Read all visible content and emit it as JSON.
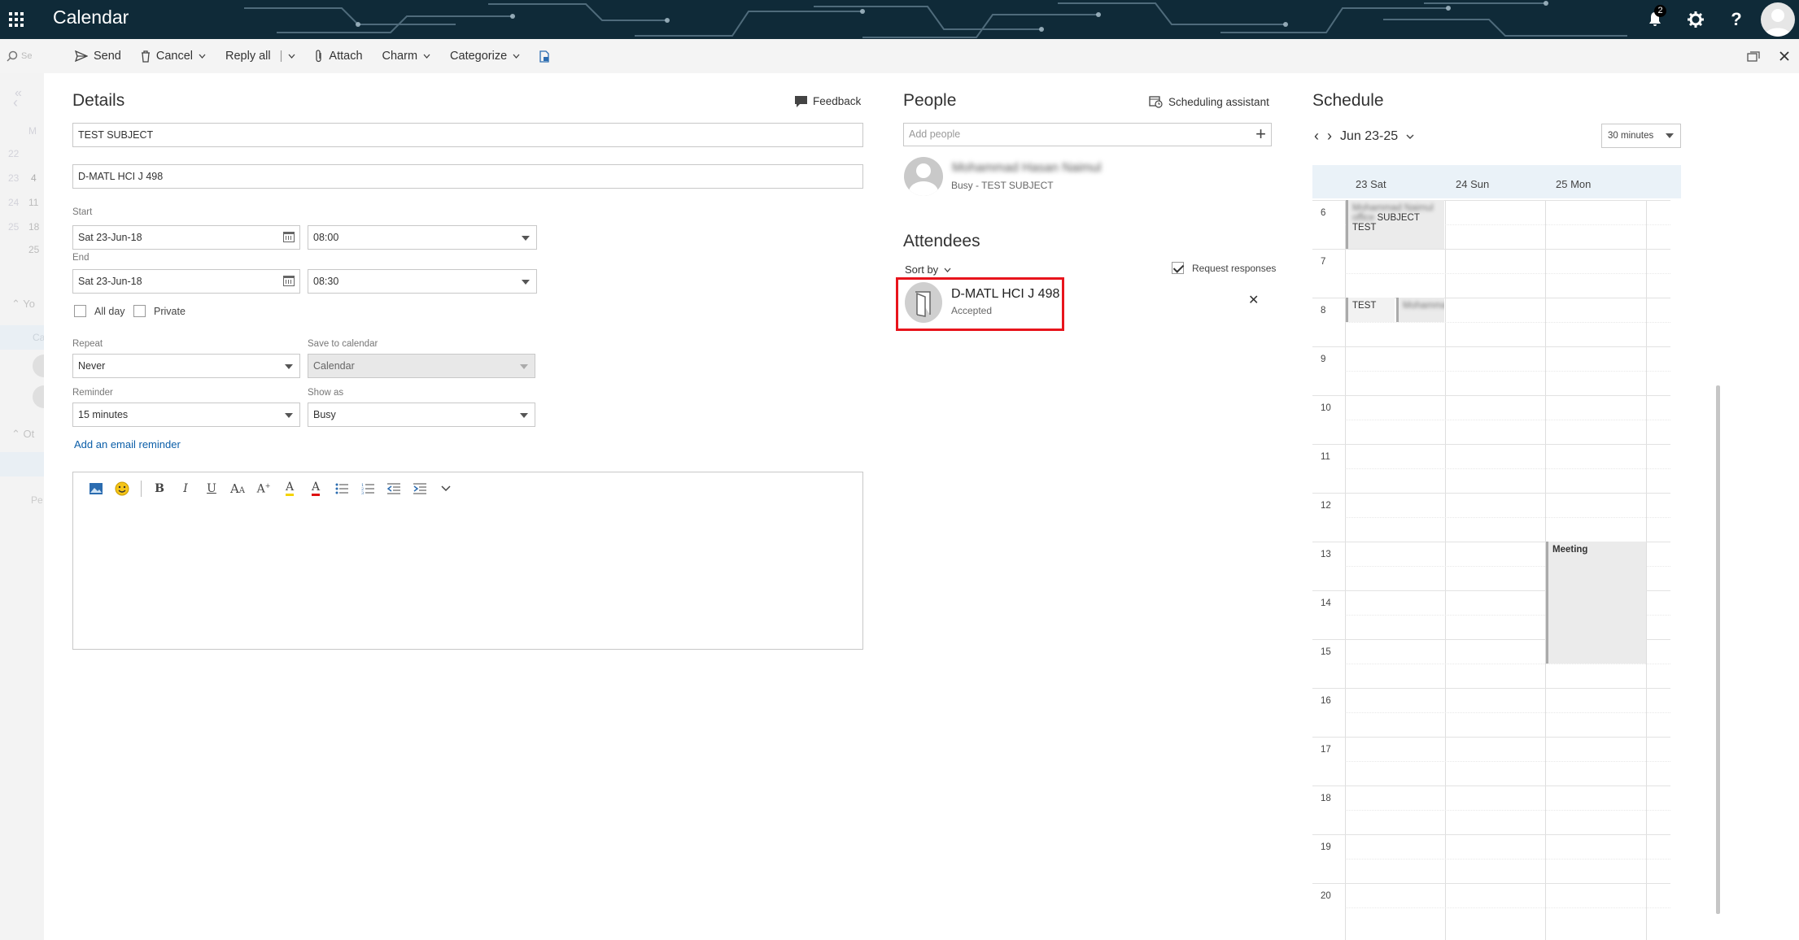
{
  "app": {
    "title": "Calendar",
    "notification_count": "2"
  },
  "toolbar": {
    "search_placeholder": "Se",
    "send": "Send",
    "cancel": "Cancel",
    "reply_all": "Reply all",
    "attach": "Attach",
    "charm": "Charm",
    "categorize": "Categorize"
  },
  "rail": {
    "month_letter": "M",
    "week_nums": [
      "22",
      "23",
      "24",
      "25"
    ],
    "dates": [
      "4",
      "11",
      "18",
      "25"
    ],
    "your_calendars": "Yo",
    "other_calendars": "Ot",
    "cal_item": "Ca",
    "people": "Pe"
  },
  "details": {
    "title": "Details",
    "feedback": "Feedback",
    "subject": "TEST SUBJECT",
    "location": "D-MATL HCI J 498",
    "start_label": "Start",
    "start_date": "Sat 23-Jun-18",
    "start_time": "08:00",
    "end_label": "End",
    "end_date": "Sat 23-Jun-18",
    "end_time": "08:30",
    "all_day": "All day",
    "private": "Private",
    "repeat_label": "Repeat",
    "repeat_value": "Never",
    "save_label": "Save to calendar",
    "save_value": "Calendar",
    "reminder_label": "Reminder",
    "reminder_value": "15 minutes",
    "show_as_label": "Show as",
    "show_as_value": "Busy",
    "email_reminder": "Add an email reminder"
  },
  "people": {
    "title": "People",
    "scheduling_assistant": "Scheduling assistant",
    "add_placeholder": "Add people",
    "organizer_name": "Mohammad Hasan Naimul",
    "organizer_status": "Busy - TEST SUBJECT"
  },
  "attendees": {
    "title": "Attendees",
    "sort_by": "Sort by",
    "request_responses": "Request responses",
    "list": [
      {
        "name": "D-MATL HCI J 498",
        "status": "Accepted"
      }
    ]
  },
  "schedule": {
    "title": "Schedule",
    "range": "Jun 23-25",
    "interval": "30 minutes",
    "days": [
      "23 Sat",
      "24 Sun",
      "25 Mon"
    ],
    "hours": [
      "6",
      "7",
      "8",
      "9",
      "10",
      "11",
      "12",
      "13",
      "14",
      "15",
      "16",
      "17",
      "18",
      "19",
      "20"
    ],
    "events": {
      "e1_blur": "Mohammad Naimul office",
      "e1_text": "SUBJECT TEST",
      "e2_text": "TEST",
      "e3_blur": "Mohammad",
      "e4_text": "Meeting"
    }
  }
}
